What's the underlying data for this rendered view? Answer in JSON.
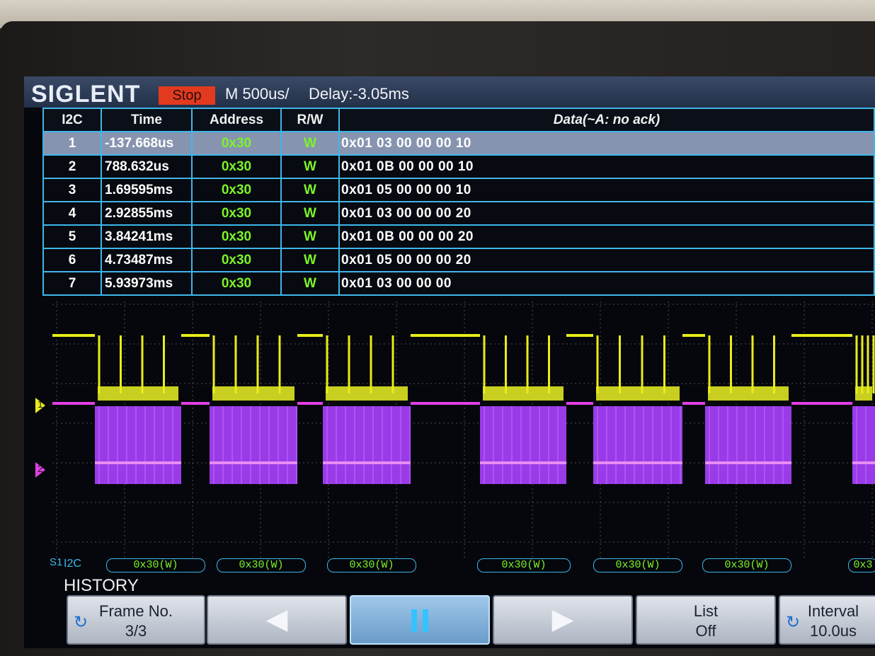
{
  "header": {
    "brand": "SIGLENT",
    "run_state": "Stop",
    "timebase": "M 500us/",
    "delay": "Delay:-3.05ms"
  },
  "table": {
    "columns": [
      "I2C",
      "Time",
      "Address",
      "R/W",
      "Data(~A: no ack)"
    ],
    "rows": [
      {
        "index": "1",
        "time": "-137.668us",
        "address": "0x30",
        "rw": "W",
        "data": "0x01 03 00 00 00 10"
      },
      {
        "index": "2",
        "time": "788.632us",
        "address": "0x30",
        "rw": "W",
        "data": "0x01 0B 00 00 00 10"
      },
      {
        "index": "3",
        "time": "1.69595ms",
        "address": "0x30",
        "rw": "W",
        "data": "0x01 05 00 00 00 10"
      },
      {
        "index": "4",
        "time": "2.92855ms",
        "address": "0x30",
        "rw": "W",
        "data": "0x01 03 00 00 00 20"
      },
      {
        "index": "5",
        "time": "3.84241ms",
        "address": "0x30",
        "rw": "W",
        "data": "0x01 0B 00 00 00 20"
      },
      {
        "index": "6",
        "time": "4.73487ms",
        "address": "0x30",
        "rw": "W",
        "data": "0x01 05 00 00 00 20"
      },
      {
        "index": "7",
        "time": "5.93973ms",
        "address": "0x30",
        "rw": "W",
        "data": "0x01 03 00 00 00"
      }
    ]
  },
  "channels": {
    "ch1": {
      "label": "1",
      "color": "#e8ec1a"
    },
    "ch2": {
      "label": "2",
      "color": "#b23cf0"
    }
  },
  "bus": {
    "tag": "S1",
    "name": "I2C",
    "packets": [
      "0x30(W)",
      "0x30(W)",
      "0x30(W)",
      "0x30(W)",
      "0x30(W)",
      "0x30(W)",
      "0x3"
    ]
  },
  "history": {
    "label": "HISTORY",
    "frame_label": "Frame No.",
    "frame_value": "3/3",
    "list_label": "List",
    "list_value": "Off",
    "interval_label": "Interval",
    "interval_value": "10.0us"
  },
  "colors": {
    "accent": "#3fb6ea",
    "decode_text": "#7cf32a",
    "stop_red": "#e23a1f"
  }
}
